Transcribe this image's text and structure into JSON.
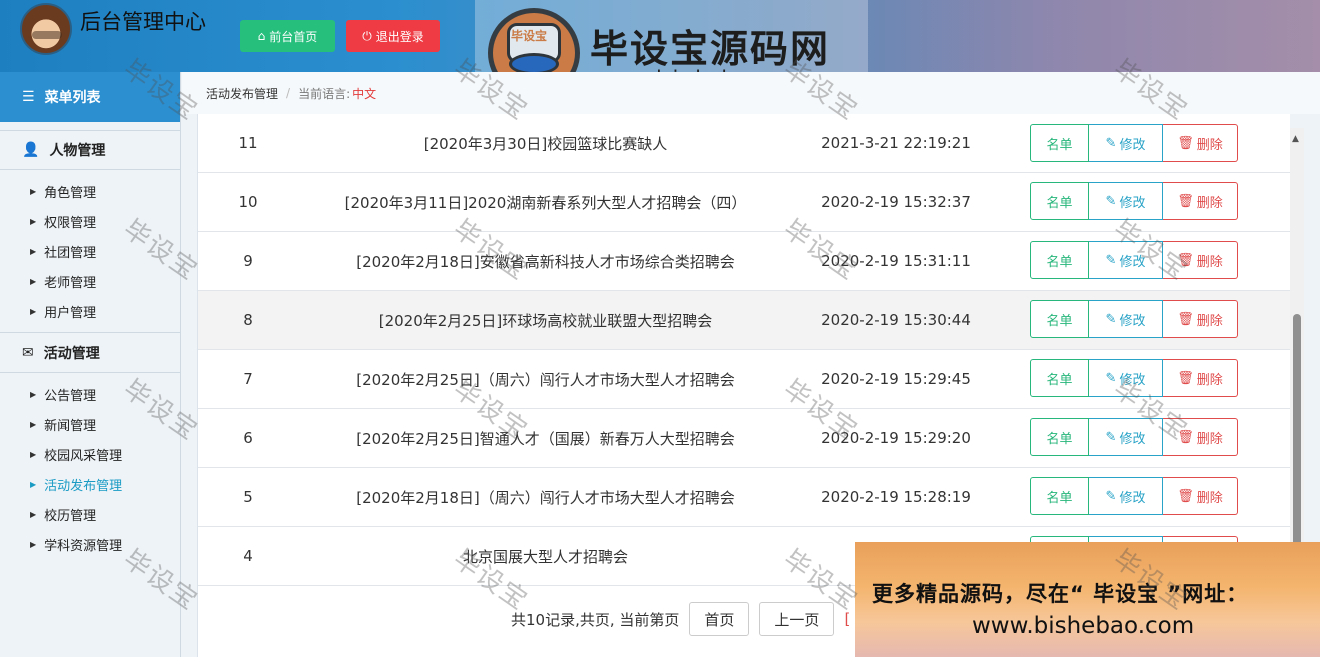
{
  "header": {
    "title": "后台管理中心",
    "home_button": "前台首页",
    "logout_button": "退出登录"
  },
  "brand": {
    "badge": "毕设宝",
    "name": "毕设宝源码网",
    "url": "www.bishebao.com"
  },
  "sidebar": {
    "menu_title": "菜单列表",
    "groups": [
      {
        "title": "人物管理",
        "items": [
          "角色管理",
          "权限管理",
          "社团管理",
          "老师管理",
          "用户管理"
        ]
      },
      {
        "title": "活动管理",
        "items": [
          "公告管理",
          "新闻管理",
          "校园风采管理",
          "活动发布管理",
          "校历管理",
          "学科资源管理"
        ]
      }
    ],
    "active_item": "活动发布管理"
  },
  "breadcrumb": {
    "page": "活动发布管理",
    "lang_label": "当前语言:",
    "lang_value": "中文"
  },
  "table": {
    "rows": [
      {
        "id": "11",
        "title": "[2020年3月30日]校园篮球比赛缺人",
        "time": "2021-3-21 22:19:21"
      },
      {
        "id": "10",
        "title": "[2020年3月11日]2020湖南新春系列大型人才招聘会（四）",
        "time": "2020-2-19 15:32:37"
      },
      {
        "id": "9",
        "title": "[2020年2月18日]安徽省高新科技人才市场综合类招聘会",
        "time": "2020-2-19 15:31:11"
      },
      {
        "id": "8",
        "title": "[2020年2月25日]环球场高校就业联盟大型招聘会",
        "time": "2020-2-19 15:30:44"
      },
      {
        "id": "7",
        "title": "[2020年2月25日]（周六）闯行人才市场大型人才招聘会",
        "time": "2020-2-19 15:29:45"
      },
      {
        "id": "6",
        "title": "[2020年2月25日]智通人才（国展）新春万人大型招聘会",
        "time": "2020-2-19 15:29:20"
      },
      {
        "id": "5",
        "title": "[2020年2月18日]（周六）闯行人才市场大型人才招聘会",
        "time": "2020-2-19 15:28:19"
      },
      {
        "id": "4",
        "title": "北京国展大型人才招聘会",
        "time": "2020-"
      }
    ],
    "actions": {
      "list": "名单",
      "edit": "修改",
      "delete": "删除"
    }
  },
  "pager": {
    "summary": "共10记录,共页, 当前第页",
    "first": "首页",
    "prev": "上一页",
    "cut": "["
  },
  "promo": {
    "line1": "更多精品源码，尽在“ 毕设宝 ”网址：",
    "line2": "www.bishebao.com"
  },
  "watermark": "毕设宝",
  "colors": {
    "header_blue": "#2b8fcf",
    "home_green": "#26bf7c",
    "logout_red": "#ee3b44",
    "active_link": "#1a9bc4",
    "delete_red": "#e04b4b"
  }
}
